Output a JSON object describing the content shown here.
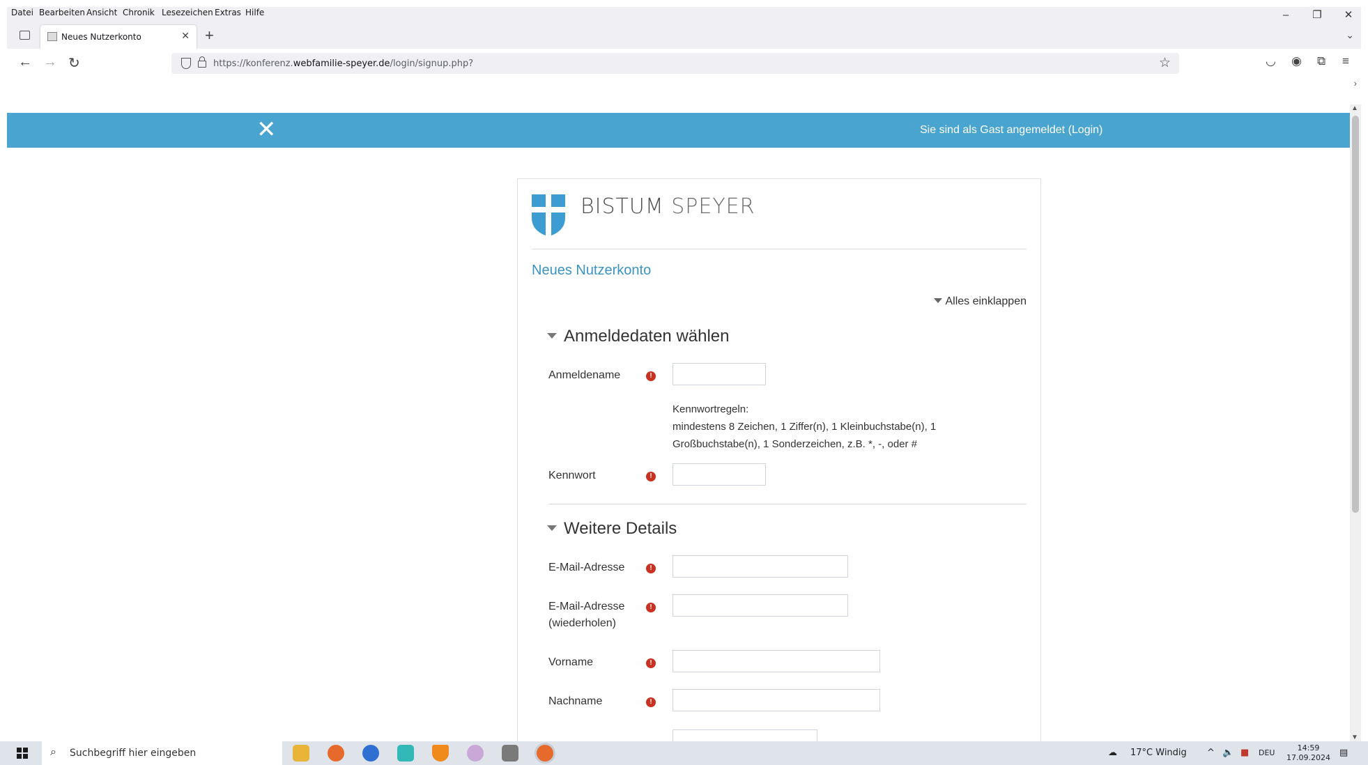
{
  "browser": {
    "menu": [
      "Datei",
      "Bearbeiten",
      "Ansicht",
      "Chronik",
      "Lesezeichen",
      "Extras",
      "Hilfe"
    ],
    "tab_title": "Neues Nutzerkonto",
    "url_prefix": "https://konferenz.",
    "url_domain": "webfamilie-speyer.de",
    "url_path": "/login/signup.php?"
  },
  "site": {
    "login_info": "Sie sind als Gast angemeldet (Login)",
    "logo_word1": "BISTUM",
    "logo_word2": "SPEYER",
    "page_title": "Neues Nutzerkonto",
    "collapse_all": "Alles einklappen",
    "colors": {
      "header": "#49a5cf",
      "link": "#3a93c0",
      "required": "#ca3120"
    }
  },
  "form": {
    "section1_title": "Anmeldedaten wählen",
    "username_label": "Anmeldename",
    "pw_rules_title": "Kennwortregeln:",
    "pw_rules_text": "mindestens 8 Zeichen, 1 Ziffer(n), 1 Kleinbuchstabe(n), 1 Großbuchstabe(n), 1 Sonderzeichen, z.B. *, -, oder #",
    "password_label": "Kennwort",
    "section2_title": "Weitere Details",
    "email_label": "E-Mail-Adresse",
    "email2_label_line1": "E-Mail-Adresse",
    "email2_label_line2": "(wiederholen)",
    "firstname_label": "Vorname",
    "lastname_label": "Nachname",
    "required_icon": "!"
  },
  "taskbar": {
    "search_placeholder": "Suchbegriff hier eingeben",
    "weather": "17°C  Windig",
    "language": "DEU",
    "time": "14:59",
    "date": "17.09.2024"
  }
}
